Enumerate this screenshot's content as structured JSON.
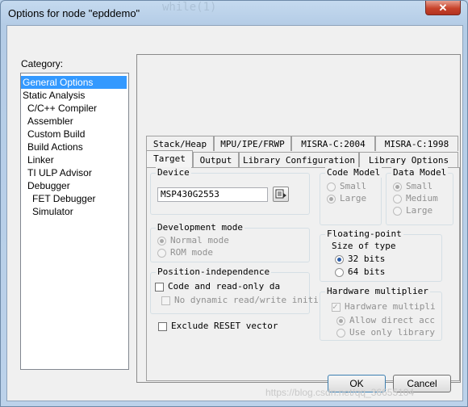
{
  "window": {
    "title": "Options for node \"epddemo\"",
    "background_code": "while(1)",
    "close_glyph": "✕"
  },
  "category": {
    "label": "Category:",
    "items": [
      "General Options",
      "Static Analysis",
      "C/C++ Compiler",
      "Assembler",
      "Custom Build",
      "Build Actions",
      "Linker",
      "TI ULP Advisor",
      "Debugger",
      "FET Debugger",
      "Simulator"
    ],
    "selected": "General Options"
  },
  "tabs": {
    "row_top": [
      "Stack/Heap",
      "MPU/IPE/FRWP",
      "MISRA-C:2004",
      "MISRA-C:1998"
    ],
    "row_bottom": [
      "Target",
      "Output",
      "Library Configuration",
      "Library Options"
    ],
    "active": "Target"
  },
  "device": {
    "title": "Device",
    "value": "MSP430G2553"
  },
  "code_model": {
    "title": "Code Model",
    "options": [
      "Small",
      "Large"
    ],
    "selected": "Large"
  },
  "data_model": {
    "title": "Data Model",
    "options": [
      "Small",
      "Medium",
      "Large"
    ],
    "selected": "Small"
  },
  "dev_mode": {
    "title": "Development mode",
    "options": [
      "Normal mode",
      "ROM mode"
    ],
    "selected": "Normal mode"
  },
  "floating_point": {
    "title": "Floating-point",
    "subtitle": "Size of type",
    "options": [
      "32 bits",
      "64 bits"
    ],
    "selected": "32 bits"
  },
  "position_independence": {
    "title": "Position-independence",
    "code_readonly": "Code and read-only da",
    "no_dynamic": "No dynamic read/write initi"
  },
  "exclude_reset": "Exclude RESET vector",
  "hw_mult": {
    "title": "Hardware multiplier",
    "checkbox": "Hardware multipli",
    "options": [
      "Allow direct acc",
      "Use only library"
    ],
    "selected": "Allow direct acc"
  },
  "buttons": {
    "ok": "OK",
    "cancel": "Cancel"
  },
  "watermark": "https://blog.csdn.net/qq_36655104"
}
